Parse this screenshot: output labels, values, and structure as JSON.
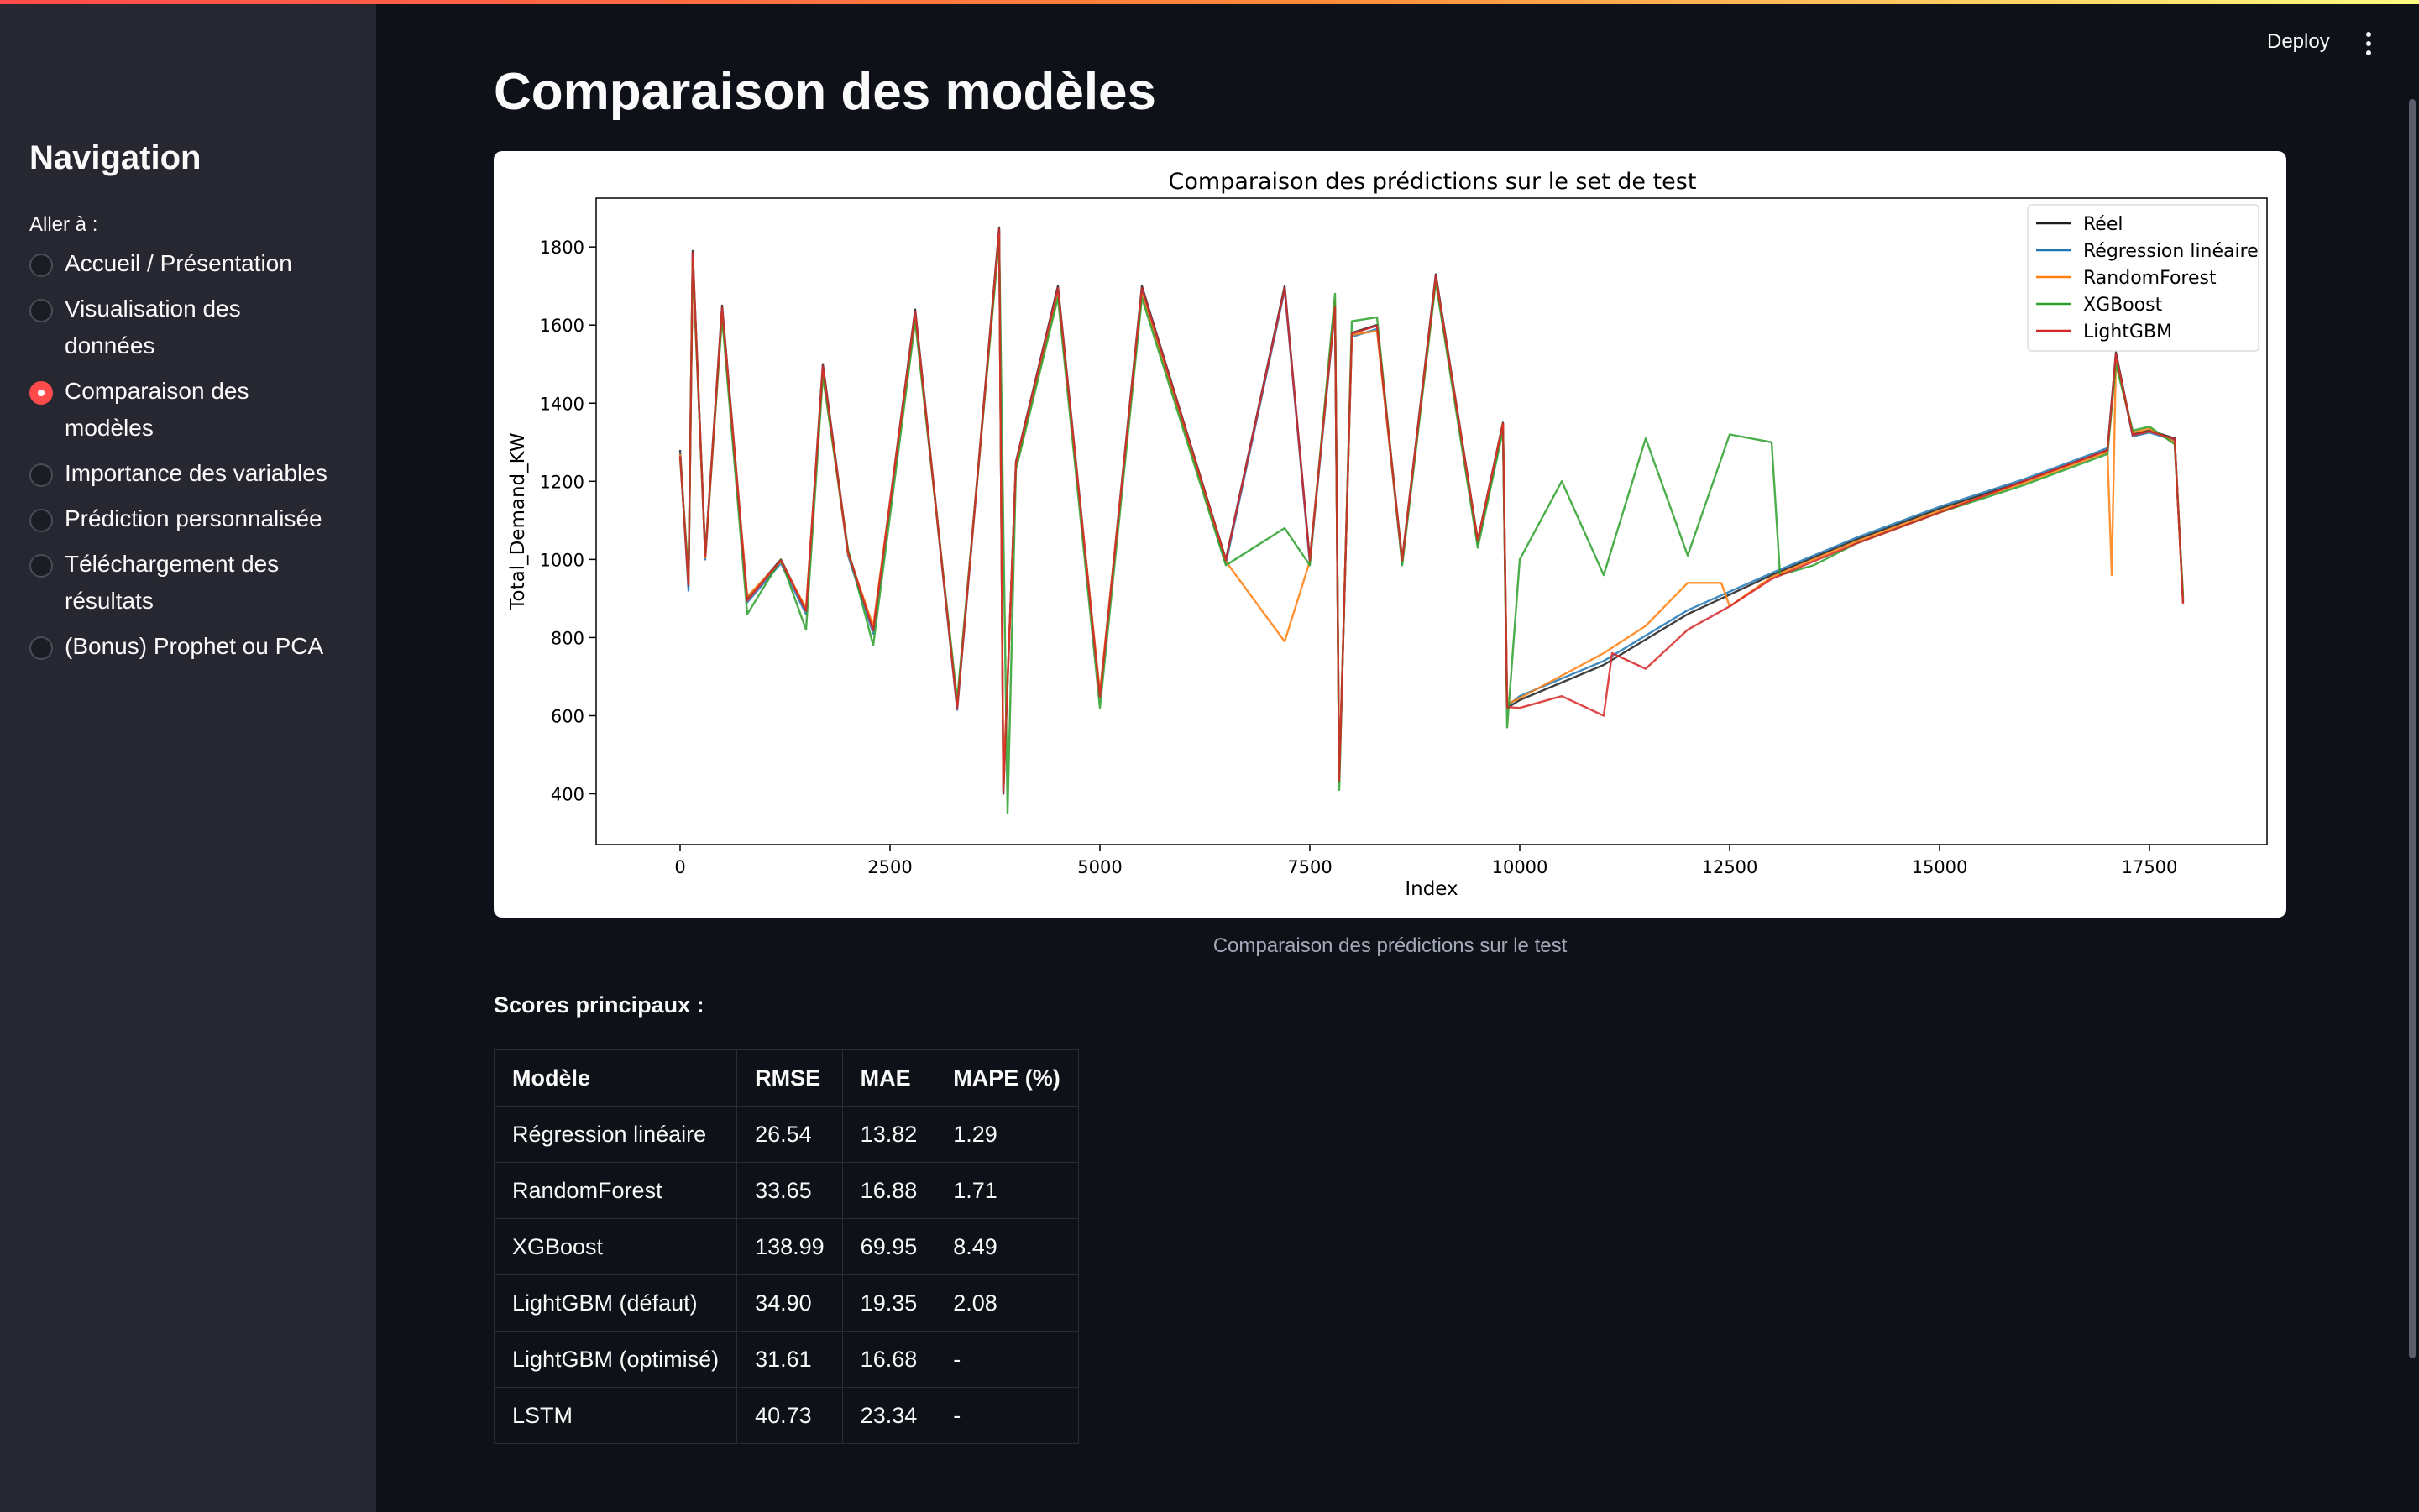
{
  "sidebar": {
    "title": "Navigation",
    "goto_label": "Aller à :",
    "items": [
      {
        "label": "Accueil / Présentation",
        "checked": false
      },
      {
        "label": "Visualisation des données",
        "checked": false
      },
      {
        "label": "Comparaison des modèles",
        "checked": true
      },
      {
        "label": "Importance des variables",
        "checked": false
      },
      {
        "label": "Prédiction personnalisée",
        "checked": false
      },
      {
        "label": "Téléchargement des résultats",
        "checked": false
      },
      {
        "label": "(Bonus) Prophet ou PCA",
        "checked": false
      }
    ]
  },
  "header": {
    "deploy_label": "Deploy",
    "menu_icon": "kebab-menu-icon"
  },
  "main": {
    "title": "Comparaison des modèles",
    "chart_caption": "Comparaison des prédictions sur le test",
    "scores_heading": "Scores principaux :",
    "table": {
      "headers": [
        "Modèle",
        "RMSE",
        "MAE",
        "MAPE (%)"
      ],
      "rows": [
        [
          "Régression linéaire",
          "26.54",
          "13.82",
          "1.29"
        ],
        [
          "RandomForest",
          "33.65",
          "16.88",
          "1.71"
        ],
        [
          "XGBoost",
          "138.99",
          "69.95",
          "8.49"
        ],
        [
          "LightGBM (défaut)",
          "34.90",
          "19.35",
          "2.08"
        ],
        [
          "LightGBM (optimisé)",
          "31.61",
          "16.68",
          "-"
        ],
        [
          "LSTM",
          "40.73",
          "23.34",
          "-"
        ]
      ]
    }
  },
  "colors": {
    "accent": "#ff4b4b",
    "background": "#0e1117",
    "sidebar": "#262730"
  },
  "chart_data": {
    "type": "line",
    "title": "Comparaison des prédictions sur le set de test",
    "xlabel": "Index",
    "ylabel": "Total_Demand_KW",
    "xlim": [
      -1000,
      18900
    ],
    "ylim": [
      270,
      1925
    ],
    "xticks": [
      0,
      2500,
      5000,
      7500,
      10000,
      12500,
      15000,
      17500
    ],
    "yticks": [
      400,
      600,
      800,
      1000,
      1200,
      1400,
      1600,
      1800
    ],
    "legend_position": "top-right",
    "series": [
      {
        "name": "Réel",
        "color": "#1f1f1f",
        "points": [
          [
            0,
            1280
          ],
          [
            100,
            930
          ],
          [
            150,
            1790
          ],
          [
            300,
            1010
          ],
          [
            500,
            1650
          ],
          [
            800,
            900
          ],
          [
            1200,
            1000
          ],
          [
            1500,
            870
          ],
          [
            1700,
            1500
          ],
          [
            2000,
            1020
          ],
          [
            2300,
            820
          ],
          [
            2800,
            1640
          ],
          [
            3300,
            620
          ],
          [
            3800,
            1850
          ],
          [
            3850,
            400
          ],
          [
            4000,
            1250
          ],
          [
            4500,
            1700
          ],
          [
            5000,
            650
          ],
          [
            5500,
            1700
          ],
          [
            6500,
            1000
          ],
          [
            7200,
            1700
          ],
          [
            7500,
            1000
          ],
          [
            7800,
            1650
          ],
          [
            7850,
            430
          ],
          [
            8000,
            1580
          ],
          [
            8300,
            1600
          ],
          [
            8600,
            1000
          ],
          [
            9000,
            1730
          ],
          [
            9500,
            1050
          ],
          [
            9800,
            1350
          ],
          [
            9850,
            620
          ],
          [
            10000,
            640
          ],
          [
            11000,
            730
          ],
          [
            12000,
            860
          ],
          [
            13000,
            960
          ],
          [
            14000,
            1050
          ],
          [
            15000,
            1130
          ],
          [
            16000,
            1200
          ],
          [
            17000,
            1280
          ],
          [
            17100,
            1530
          ],
          [
            17300,
            1320
          ],
          [
            17500,
            1330
          ],
          [
            17800,
            1310
          ],
          [
            17900,
            890
          ]
        ]
      },
      {
        "name": "Régression linéaire",
        "color": "#1f77b4",
        "points": [
          [
            0,
            1275
          ],
          [
            100,
            920
          ],
          [
            150,
            1780
          ],
          [
            300,
            1000
          ],
          [
            500,
            1640
          ],
          [
            800,
            890
          ],
          [
            1200,
            990
          ],
          [
            1500,
            860
          ],
          [
            1700,
            1490
          ],
          [
            2000,
            1010
          ],
          [
            2300,
            810
          ],
          [
            2800,
            1630
          ],
          [
            3300,
            615
          ],
          [
            3800,
            1840
          ],
          [
            3850,
            410
          ],
          [
            4000,
            1245
          ],
          [
            4500,
            1690
          ],
          [
            5000,
            655
          ],
          [
            5500,
            1690
          ],
          [
            6500,
            990
          ],
          [
            7200,
            1690
          ],
          [
            7500,
            990
          ],
          [
            7800,
            1640
          ],
          [
            7850,
            440
          ],
          [
            8000,
            1570
          ],
          [
            8300,
            1590
          ],
          [
            8600,
            990
          ],
          [
            9000,
            1720
          ],
          [
            9500,
            1040
          ],
          [
            9800,
            1340
          ],
          [
            9850,
            625
          ],
          [
            10000,
            650
          ],
          [
            11000,
            740
          ],
          [
            12000,
            870
          ],
          [
            13000,
            965
          ],
          [
            14000,
            1055
          ],
          [
            15000,
            1135
          ],
          [
            16000,
            1205
          ],
          [
            17000,
            1285
          ],
          [
            17100,
            1520
          ],
          [
            17300,
            1315
          ],
          [
            17500,
            1325
          ],
          [
            17800,
            1305
          ],
          [
            17900,
            895
          ]
        ]
      },
      {
        "name": "RandomForest",
        "color": "#ff7f0e",
        "points": [
          [
            0,
            1270
          ],
          [
            100,
            940
          ],
          [
            150,
            1770
          ],
          [
            300,
            1005
          ],
          [
            500,
            1630
          ],
          [
            800,
            905
          ],
          [
            1200,
            995
          ],
          [
            1500,
            875
          ],
          [
            1700,
            1480
          ],
          [
            2000,
            1015
          ],
          [
            2300,
            830
          ],
          [
            2800,
            1620
          ],
          [
            3300,
            630
          ],
          [
            3800,
            1830
          ],
          [
            3850,
            420
          ],
          [
            4000,
            1240
          ],
          [
            4500,
            1680
          ],
          [
            5000,
            660
          ],
          [
            5500,
            1680
          ],
          [
            6500,
            995
          ],
          [
            7200,
            790
          ],
          [
            7500,
            995
          ],
          [
            7800,
            1660
          ],
          [
            7850,
            440
          ],
          [
            8000,
            1575
          ],
          [
            8300,
            1585
          ],
          [
            8600,
            995
          ],
          [
            9000,
            1715
          ],
          [
            9500,
            1045
          ],
          [
            9800,
            1345
          ],
          [
            9850,
            630
          ],
          [
            10000,
            645
          ],
          [
            11000,
            760
          ],
          [
            11500,
            830
          ],
          [
            12000,
            940
          ],
          [
            12400,
            940
          ],
          [
            12500,
            880
          ],
          [
            13000,
            955
          ],
          [
            14000,
            1045
          ],
          [
            15000,
            1125
          ],
          [
            16000,
            1195
          ],
          [
            17000,
            1275
          ],
          [
            17050,
            960
          ],
          [
            17100,
            1510
          ],
          [
            17300,
            1325
          ],
          [
            17500,
            1335
          ],
          [
            17800,
            1300
          ],
          [
            17900,
            900
          ]
        ]
      },
      {
        "name": "XGBoost",
        "color": "#2ca02c",
        "points": [
          [
            0,
            1260
          ],
          [
            100,
            960
          ],
          [
            150,
            1760
          ],
          [
            300,
            1015
          ],
          [
            500,
            1620
          ],
          [
            800,
            860
          ],
          [
            1200,
            1000
          ],
          [
            1500,
            820
          ],
          [
            1700,
            1470
          ],
          [
            2000,
            1025
          ],
          [
            2300,
            780
          ],
          [
            2800,
            1610
          ],
          [
            3300,
            640
          ],
          [
            3800,
            1820
          ],
          [
            3900,
            350
          ],
          [
            4000,
            1230
          ],
          [
            4500,
            1670
          ],
          [
            5000,
            620
          ],
          [
            5500,
            1670
          ],
          [
            6500,
            985
          ],
          [
            7200,
            1080
          ],
          [
            7500,
            985
          ],
          [
            7800,
            1680
          ],
          [
            7850,
            410
          ],
          [
            8000,
            1610
          ],
          [
            8300,
            1620
          ],
          [
            8600,
            985
          ],
          [
            9000,
            1710
          ],
          [
            9500,
            1030
          ],
          [
            9800,
            1330
          ],
          [
            9850,
            570
          ],
          [
            10000,
            1000
          ],
          [
            10500,
            1200
          ],
          [
            11000,
            960
          ],
          [
            11500,
            1310
          ],
          [
            12000,
            1010
          ],
          [
            12500,
            1320
          ],
          [
            13000,
            1300
          ],
          [
            13100,
            960
          ],
          [
            13500,
            985
          ],
          [
            14000,
            1040
          ],
          [
            15000,
            1120
          ],
          [
            16000,
            1190
          ],
          [
            17000,
            1270
          ],
          [
            17100,
            1500
          ],
          [
            17300,
            1330
          ],
          [
            17500,
            1340
          ],
          [
            17800,
            1295
          ],
          [
            17900,
            905
          ]
        ]
      },
      {
        "name": "LightGBM",
        "color": "#d62728",
        "points": [
          [
            0,
            1265
          ],
          [
            100,
            935
          ],
          [
            150,
            1785
          ],
          [
            300,
            1008
          ],
          [
            500,
            1645
          ],
          [
            800,
            895
          ],
          [
            1200,
            998
          ],
          [
            1500,
            868
          ],
          [
            1700,
            1495
          ],
          [
            2000,
            1018
          ],
          [
            2300,
            818
          ],
          [
            2800,
            1635
          ],
          [
            3300,
            618
          ],
          [
            3800,
            1845
          ],
          [
            3850,
            405
          ],
          [
            4000,
            1248
          ],
          [
            4500,
            1695
          ],
          [
            5000,
            648
          ],
          [
            5500,
            1695
          ],
          [
            6500,
            998
          ],
          [
            7200,
            1695
          ],
          [
            7500,
            998
          ],
          [
            7800,
            1645
          ],
          [
            7850,
            435
          ],
          [
            8000,
            1578
          ],
          [
            8300,
            1598
          ],
          [
            8600,
            998
          ],
          [
            9000,
            1725
          ],
          [
            9500,
            1048
          ],
          [
            9800,
            1348
          ],
          [
            9850,
            622
          ],
          [
            10000,
            620
          ],
          [
            10500,
            650
          ],
          [
            11000,
            600
          ],
          [
            11100,
            760
          ],
          [
            11500,
            720
          ],
          [
            12000,
            820
          ],
          [
            12500,
            880
          ],
          [
            13000,
            950
          ],
          [
            14000,
            1040
          ],
          [
            15000,
            1120
          ],
          [
            16000,
            1200
          ],
          [
            17000,
            1280
          ],
          [
            17100,
            1525
          ],
          [
            17300,
            1318
          ],
          [
            17500,
            1328
          ],
          [
            17800,
            1308
          ],
          [
            17900,
            885
          ]
        ]
      }
    ]
  }
}
